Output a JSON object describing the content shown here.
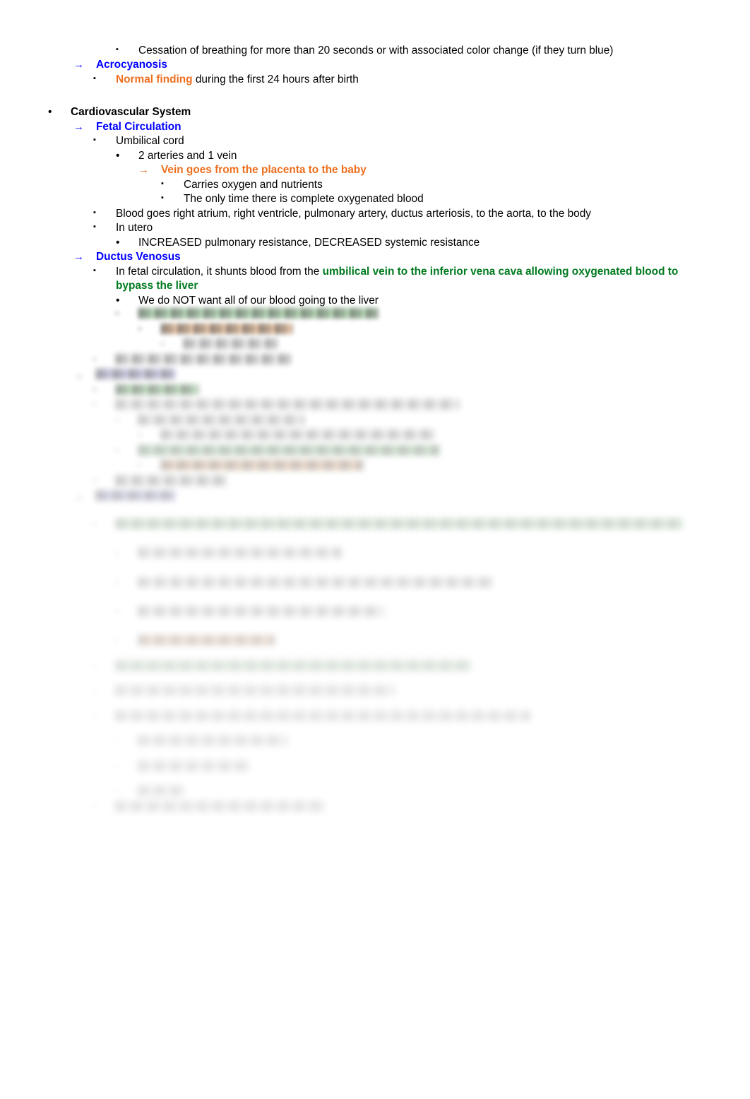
{
  "document": {
    "type": "study-notes-outline",
    "title_visible": false,
    "colors": {
      "heading_blue": "#0000FF",
      "emphasis_orange": "#ED6F1F",
      "emphasis_green": "#007A1F",
      "highlight_green": "#B5E6B5",
      "highlight_orange": "#FAC79B",
      "highlight_blue": "#C7C7F7",
      "body_text": "#000000",
      "page_background": "#FFFFFF"
    },
    "markers": {
      "disc": "•",
      "arrow": "→",
      "square": "▪"
    }
  },
  "outline": {
    "apnea_line": "Cessation of breathing for more than 20 seconds or with associated color change (if they turn blue)",
    "acrocyanosis_heading": "Acrocyanosis",
    "normal_finding_label": "Normal finding",
    "normal_finding_rest": "during the first 24 hours after birth",
    "cardiovascular_system_heading": "Cardiovascular System",
    "fetal_circulation_heading": "Fetal Circulation",
    "umbilical_cord": "Umbilical cord",
    "two_arteries_one_vein": "2 arteries and 1 vein",
    "vein_placenta_to_baby": "Vein goes from the placenta to the baby",
    "carries_oxygen_nutrients": "Carries oxygen and nutrients",
    "only_time_complete_oxygenated": "The only time there is complete oxygenated blood",
    "blood_goes_path": "Blood goes right atrium, right ventricle, pulmonary artery, ductus arteriosis, to the aorta, to the body",
    "in_utero": "In utero",
    "increased_pulmonary_resistance": "INCREASED pulmonary resistance, DECREASED systemic resistance",
    "ductus_venosus_heading": "Ductus Venosus",
    "ductus_venosus_desc_plain": "In fetal circulation, it shunts blood from the ",
    "ductus_venosus_desc_green": "umbilical vein to the inferior vena cava allowing oxygenated blood to bypass the liver",
    "we_do_not_want_liver": "We do NOT want all of our blood going to the liver"
  },
  "obscured": {
    "note": "Lower portion of the page is blurred and illegible in the source image.",
    "blocks": [
      {
        "id": "b1",
        "level": 4,
        "marker": "square",
        "width_pct": 42,
        "highlight": "green",
        "blur": 1
      },
      {
        "id": "b2",
        "level": 5,
        "marker": "square",
        "width_pct": 24,
        "highlight": "orange",
        "blur": 1
      },
      {
        "id": "b3",
        "level": 6,
        "marker": "square",
        "width_pct": 18,
        "highlight": "none",
        "blur": 2
      },
      {
        "id": "b4",
        "level": 3,
        "marker": "square",
        "width_pct": 30,
        "highlight": "none",
        "blur": 2
      },
      {
        "id": "b5",
        "level": 2,
        "marker": "arrow",
        "width_pct": 13,
        "highlight": "blue",
        "blur": 2
      },
      {
        "id": "b6",
        "level": 3,
        "marker": "square",
        "width_pct": 14,
        "highlight": "green",
        "blur": 2
      },
      {
        "id": "b7",
        "level": 3,
        "marker": "square",
        "width_pct": 58,
        "highlight": "none",
        "blur": 3
      },
      {
        "id": "b8",
        "level": 4,
        "marker": "square",
        "width_pct": 29,
        "highlight": "none",
        "blur": 3
      },
      {
        "id": "b9",
        "level": 5,
        "marker": "square",
        "width_pct": 50,
        "highlight": "none",
        "blur": 3
      },
      {
        "id": "b10",
        "level": 4,
        "marker": "square",
        "width_pct": 53,
        "highlight": "green",
        "blur": 3
      },
      {
        "id": "b11",
        "level": 5,
        "marker": "square",
        "width_pct": 37,
        "highlight": "orange",
        "blur": 3
      },
      {
        "id": "b12",
        "level": 3,
        "marker": "square",
        "width_pct": 19,
        "highlight": "none",
        "blur": 3
      },
      {
        "id": "b13",
        "level": 2,
        "marker": "arrow",
        "width_pct": 13,
        "highlight": "blue",
        "blur": 3
      },
      {
        "id": "b14",
        "level": 3,
        "marker": "square",
        "width_pct": 96,
        "highlight": "green",
        "blur": 4
      },
      {
        "id": "b15",
        "level": 4,
        "marker": "square",
        "width_pct": 36,
        "highlight": "none",
        "blur": 4
      },
      {
        "id": "b16",
        "level": 4,
        "marker": "square",
        "width_pct": 62,
        "highlight": "none",
        "blur": 4
      },
      {
        "id": "b17",
        "level": 4,
        "marker": "square",
        "width_pct": 43,
        "highlight": "none",
        "blur": 4
      },
      {
        "id": "b18",
        "level": 4,
        "marker": "square",
        "width_pct": 24,
        "highlight": "orange",
        "blur": 4
      },
      {
        "id": "b19",
        "level": 3,
        "marker": "square",
        "width_pct": 60,
        "highlight": "green",
        "blur": 5
      },
      {
        "id": "b20",
        "level": 3,
        "marker": "square",
        "width_pct": 47,
        "highlight": "none",
        "blur": 5
      },
      {
        "id": "b21",
        "level": 3,
        "marker": "square",
        "width_pct": 70,
        "highlight": "none",
        "blur": 5
      },
      {
        "id": "b22",
        "level": 4,
        "marker": "square",
        "width_pct": 26,
        "highlight": "none",
        "blur": 5
      },
      {
        "id": "b23",
        "level": 4,
        "marker": "square",
        "width_pct": 20,
        "highlight": "none",
        "blur": 5
      },
      {
        "id": "b24",
        "level": 4,
        "marker": "square",
        "width_pct": 8,
        "highlight": "none",
        "blur": 5
      },
      {
        "id": "b25",
        "level": 3,
        "marker": "square",
        "width_pct": 35,
        "highlight": "none",
        "blur": 5
      }
    ]
  }
}
